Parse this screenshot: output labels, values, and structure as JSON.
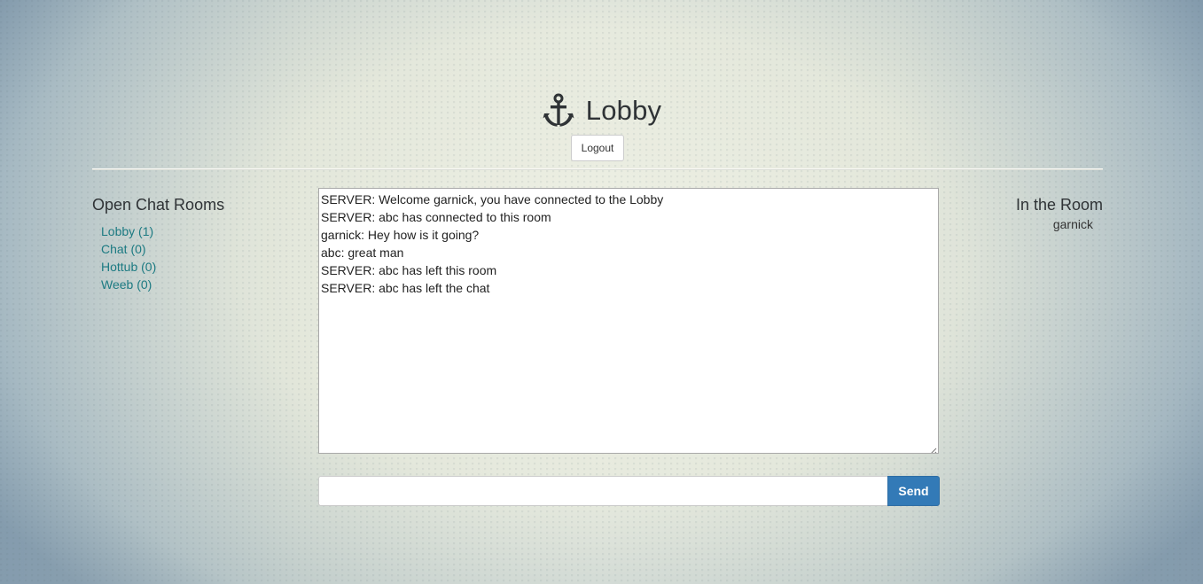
{
  "header": {
    "title": "Lobby",
    "icon": "anchor-icon",
    "logout_label": "Logout"
  },
  "rooms": {
    "heading": "Open Chat Rooms",
    "items": [
      {
        "label": "Lobby (1)"
      },
      {
        "label": "Chat (0)"
      },
      {
        "label": "Hottub (0)"
      },
      {
        "label": "Weeb (0)"
      }
    ]
  },
  "chat": {
    "messages": [
      "SERVER: Welcome garnick, you have connected to the Lobby",
      "SERVER: abc has connected to this room",
      "garnick: Hey how is it going?",
      "abc: great man",
      "SERVER: abc has left this room",
      "SERVER: abc has left the chat"
    ]
  },
  "occupants": {
    "heading": "In the Room",
    "users": [
      "garnick"
    ]
  },
  "composer": {
    "value": "",
    "send_label": "Send"
  },
  "colors": {
    "link": "#1c7a82",
    "primary_button": "#337ab7",
    "text": "#333333"
  }
}
